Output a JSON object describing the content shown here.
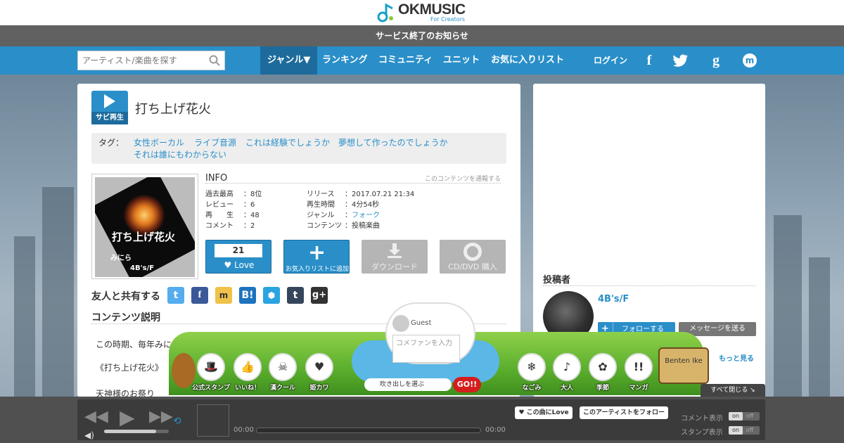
{
  "logo": {
    "text": "OKMUSIC",
    "sub": "For Creators"
  },
  "notice": "サービス終了のお知らせ",
  "search": {
    "placeholder": "アーティスト/楽曲を探す"
  },
  "nav": {
    "items": [
      "ジャンル▼",
      "ランキング",
      "コミュニティ",
      "ユニット",
      "お気に入りリスト"
    ],
    "login": "ログイン"
  },
  "song": {
    "sabi_label": "サビ再生",
    "title": "打ち上げ花火"
  },
  "tags": {
    "label": "タグ：",
    "items": [
      "女性ボーカル",
      "ライブ音源",
      "これは経験でしょうか",
      "夢想して作ったのでしょうか",
      "それは誰にもわからない"
    ]
  },
  "jacket": {
    "title": "打ち上げ花火",
    "line1": "みにら",
    "line2": "4B's/F"
  },
  "info": {
    "heading": "INFO",
    "report": "このコンテンツを通報する",
    "left": [
      {
        "k": "過去最高",
        "v": "8位"
      },
      {
        "k": "レビュー",
        "v": "6"
      },
      {
        "k": "再　　生",
        "v": "48"
      },
      {
        "k": "コメント",
        "v": "2"
      }
    ],
    "right": [
      {
        "k": "リリース",
        "v": "2017.07.21 21:34"
      },
      {
        "k": "再生時間",
        "v": "4分54秒"
      },
      {
        "k": "ジャンル",
        "v": "フォーク"
      },
      {
        "k": "コンテンツ",
        "v": "投稿楽曲"
      }
    ],
    "colon": "："
  },
  "actions": {
    "love_count": "21",
    "love": "Love",
    "fav": "お気入りリストに追加",
    "download": "ダウンロード",
    "cd": "CD/DVD 購入"
  },
  "share": {
    "heading": "友人と共有する"
  },
  "description": {
    "heading": "コンテンツ説明",
    "lines": [
      "この時期、毎年みにら",
      "《打ち上げ花火》",
      "天神様のお祭り"
    ]
  },
  "poster": {
    "heading": "投稿者",
    "name": "4B's/F",
    "follow": "フォローする",
    "message": "メッセージを送る",
    "more": "もっと見る"
  },
  "overlay": {
    "guest": "Guest",
    "comment_placeholder": "コメファンを入力",
    "bubble": "吹き出しを選ぶ",
    "go": "GO!!",
    "stamps_left": [
      "公式スタンプ",
      "いいね！",
      "漢クール",
      "姫カワ"
    ],
    "stamps_right": [
      "なごみ",
      "大人",
      "季節",
      "マンガ"
    ],
    "benten": "Benten Ike",
    "close_all": "すべて閉じる"
  },
  "player": {
    "time_start": "00:00",
    "time_end": "00:00",
    "love_song": "この曲にLove",
    "follow_artist": "このアーティストをフォロー",
    "comment_display": "コメント表示",
    "stamp_display": "スタンプ表示",
    "on": "on",
    "off": "off",
    "volume": 0.8
  }
}
